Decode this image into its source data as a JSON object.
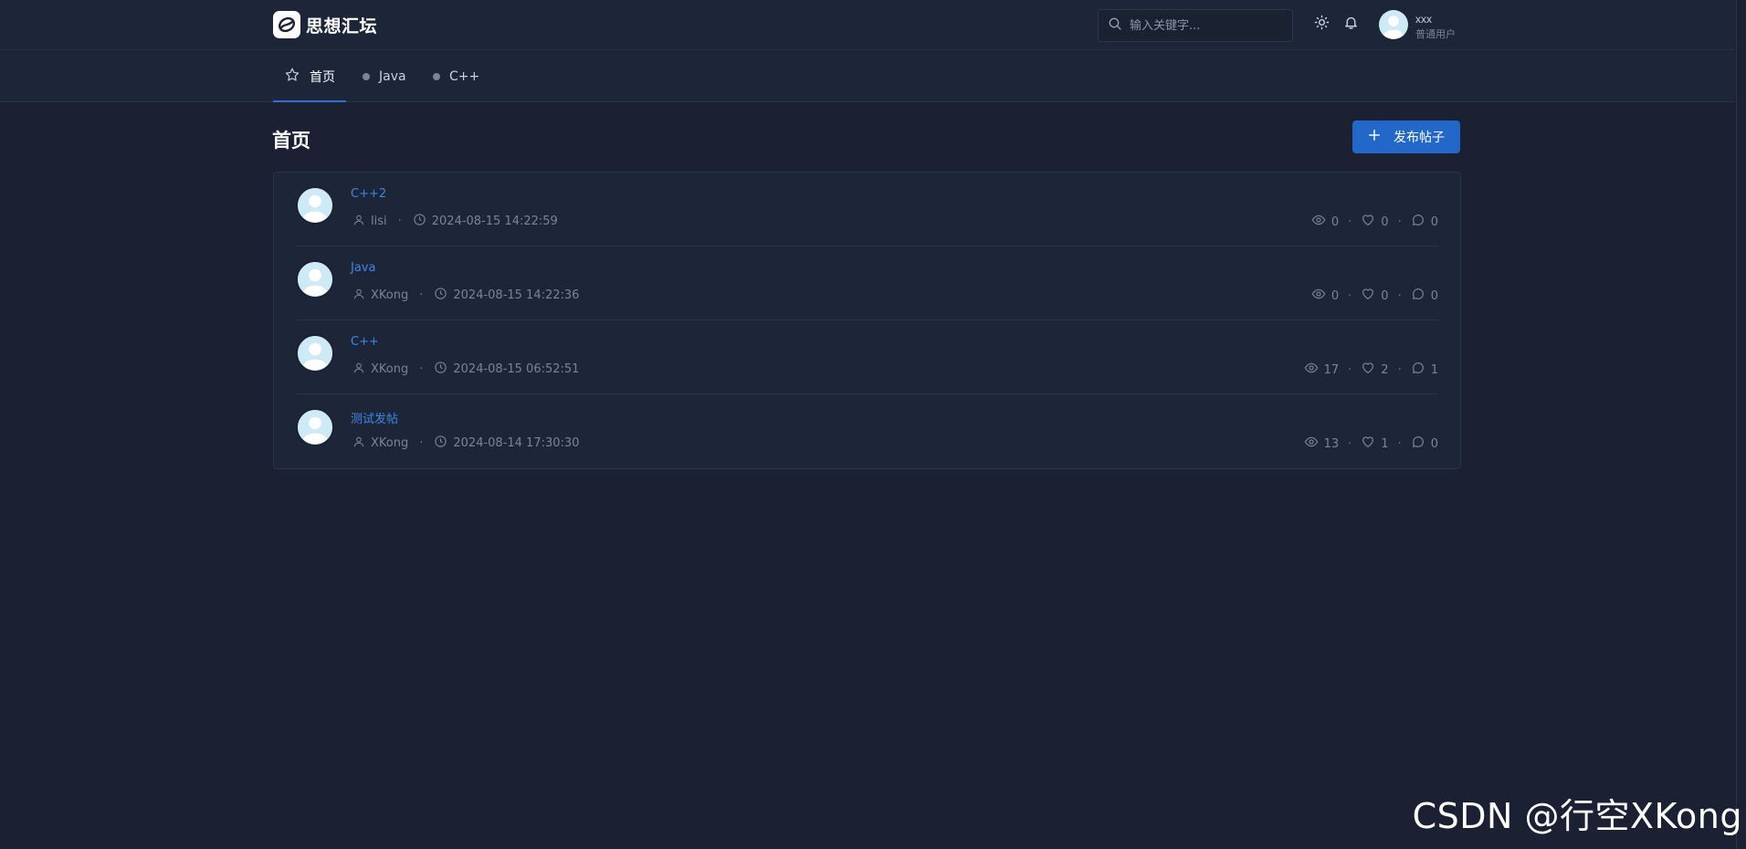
{
  "header": {
    "site_name": "思想汇坛",
    "search_placeholder": "输入关键字...",
    "user": {
      "name": "xxx",
      "role": "普通用户"
    }
  },
  "nav": {
    "items": [
      {
        "label": "首页",
        "icon": "star-icon",
        "active": true
      },
      {
        "label": "Java",
        "icon": "dot",
        "active": false
      },
      {
        "label": "C++",
        "icon": "dot",
        "active": false
      }
    ]
  },
  "main": {
    "page_title": "首页",
    "publish_label": "发布帖子"
  },
  "posts": [
    {
      "title": "C++2",
      "author": "lisi",
      "time": "2024-08-15 14:22:59",
      "views": "0",
      "likes": "0",
      "comments": "0"
    },
    {
      "title": "Java",
      "author": "XKong",
      "time": "2024-08-15 14:22:36",
      "views": "0",
      "likes": "0",
      "comments": "0"
    },
    {
      "title": "C++",
      "author": "XKong",
      "time": "2024-08-15 06:52:51",
      "views": "17",
      "likes": "2",
      "comments": "1"
    },
    {
      "title": "测试发帖",
      "author": "XKong",
      "time": "2024-08-14 17:30:30",
      "views": "13",
      "likes": "1",
      "comments": "0"
    }
  ],
  "watermark": "CSDN @行空XKong",
  "colors": {
    "background": "#1b2133",
    "panel": "#1d2638",
    "accent": "#2367c9",
    "link": "#3e86e8"
  }
}
